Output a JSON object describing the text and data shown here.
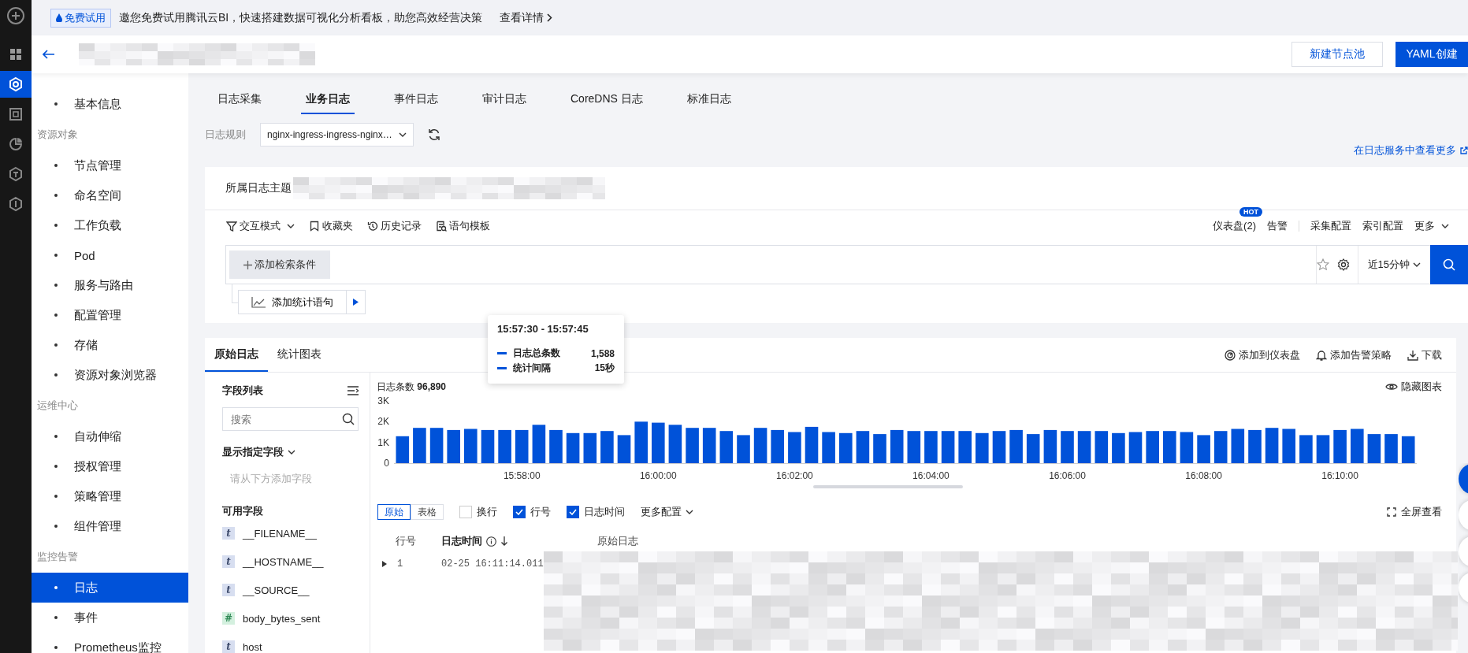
{
  "banner": {
    "tag": "免费试用",
    "message": "邀您免费试用腾讯云BI，快速搭建数据可视化分析看板，助您高效经营决策",
    "link": "查看详情"
  },
  "rail": {
    "items": [
      {
        "kind": "grid",
        "selected": false
      },
      {
        "kind": "hexagon",
        "selected": true
      },
      {
        "kind": "square",
        "selected": false
      },
      {
        "kind": "pie",
        "selected": false
      },
      {
        "kind": "hex-t",
        "selected": false
      },
      {
        "kind": "hex-i",
        "selected": false
      }
    ]
  },
  "header": {
    "buttons": [
      {
        "label": "新建节点池",
        "primary": false
      },
      {
        "label": "YAML创建",
        "primary": true
      }
    ]
  },
  "sidebar": {
    "items": [
      {
        "kind": "item",
        "label": "基本信息",
        "selected": false
      },
      {
        "kind": "group",
        "label": "资源对象"
      },
      {
        "kind": "item",
        "label": "节点管理",
        "selected": false
      },
      {
        "kind": "item",
        "label": "命名空间",
        "selected": false
      },
      {
        "kind": "item",
        "label": "工作负载",
        "selected": false
      },
      {
        "kind": "item",
        "label": "Pod",
        "selected": false
      },
      {
        "kind": "item",
        "label": "服务与路由",
        "selected": false
      },
      {
        "kind": "item",
        "label": "配置管理",
        "selected": false
      },
      {
        "kind": "item",
        "label": "存储",
        "selected": false
      },
      {
        "kind": "item",
        "label": "资源对象浏览器",
        "selected": false
      },
      {
        "kind": "group",
        "label": "运维中心"
      },
      {
        "kind": "item",
        "label": "自动伸缩",
        "selected": false
      },
      {
        "kind": "item",
        "label": "授权管理",
        "selected": false
      },
      {
        "kind": "item",
        "label": "策略管理",
        "selected": false
      },
      {
        "kind": "item",
        "label": "组件管理",
        "selected": false
      },
      {
        "kind": "group",
        "label": "监控告警"
      },
      {
        "kind": "item",
        "label": "日志",
        "selected": true
      },
      {
        "kind": "item",
        "label": "事件",
        "selected": false
      },
      {
        "kind": "item",
        "label": "Prometheus监控",
        "selected": false
      }
    ]
  },
  "tabs": [
    {
      "label": "日志采集",
      "selected": false
    },
    {
      "label": "业务日志",
      "selected": true
    },
    {
      "label": "事件日志",
      "selected": false
    },
    {
      "label": "审计日志",
      "selected": false
    },
    {
      "label": "CoreDNS 日志",
      "selected": false
    },
    {
      "label": "标准日志",
      "selected": false
    }
  ],
  "rule": {
    "label": "日志规则",
    "value": "nginx-ingress-ingress-nginx…"
  },
  "more_link": "在日志服务中查看更多",
  "topic": {
    "label": "所属日志主题"
  },
  "query_toolbar": {
    "left": [
      {
        "kind": "filter",
        "label": "交互模式",
        "dropdown": true
      },
      {
        "kind": "bookmark",
        "label": "收藏夹",
        "dropdown": false
      },
      {
        "kind": "history",
        "label": "历史记录",
        "dropdown": false
      },
      {
        "kind": "template",
        "label": "语句模板",
        "dropdown": false
      }
    ],
    "right": [
      {
        "label": "仪表盘(2)",
        "badge": "HOT",
        "dropdown": false
      },
      {
        "label": "告警",
        "dropdown": false
      },
      {
        "label": "采集配置",
        "dropdown": false
      },
      {
        "label": "索引配置",
        "dropdown": false
      },
      {
        "label": "更多",
        "dropdown": true
      }
    ]
  },
  "search": {
    "add_condition": "添加检索条件",
    "add_stats": "添加统计语句",
    "time_range": "近15分钟"
  },
  "results": {
    "tabs": [
      {
        "label": "原始日志",
        "selected": true
      },
      {
        "label": "统计图表",
        "selected": false
      }
    ],
    "actions": [
      {
        "kind": "dashboard",
        "label": "添加到仪表盘"
      },
      {
        "kind": "bell",
        "label": "添加告警策略"
      },
      {
        "kind": "download",
        "label": "下载"
      }
    ]
  },
  "fields": {
    "title": "字段列表",
    "search_placeholder": "搜索",
    "display_title": "显示指定字段",
    "display_hint": "请从下方添加字段",
    "available_title": "可用字段",
    "items": [
      {
        "type": "t",
        "name": "__FILENAME__"
      },
      {
        "type": "t",
        "name": "__HOSTNAME__"
      },
      {
        "type": "t",
        "name": "__SOURCE__"
      },
      {
        "type": "#",
        "name": "body_bytes_sent"
      },
      {
        "type": "t",
        "name": "host"
      }
    ]
  },
  "chart": {
    "count_label": "日志条数",
    "count": "96,890",
    "hide": "隐藏图表",
    "chart_data": {
      "type": "bar",
      "ylim": [
        0,
        3000
      ],
      "yticks": [
        {
          "value": 0,
          "label": "0"
        },
        {
          "value": 1000,
          "label": "1K"
        },
        {
          "value": 2000,
          "label": "2K"
        },
        {
          "value": 3000,
          "label": "3K"
        }
      ],
      "categories": [
        null,
        null,
        null,
        null,
        null,
        null,
        null,
        "15:58:00",
        null,
        null,
        null,
        null,
        null,
        null,
        null,
        "16:00:00",
        null,
        null,
        null,
        null,
        null,
        null,
        null,
        "16:02:00",
        null,
        null,
        null,
        null,
        null,
        null,
        null,
        "16:04:00",
        null,
        null,
        null,
        null,
        null,
        null,
        null,
        "16:06:00",
        null,
        null,
        null,
        null,
        null,
        null,
        null,
        "16:08:00",
        null,
        null,
        null,
        null,
        null,
        null,
        null,
        "16:10:00",
        null,
        null,
        null,
        null
      ],
      "values": [
        1300,
        1700,
        1700,
        1600,
        1650,
        1600,
        1600,
        1600,
        1850,
        1600,
        1450,
        1450,
        1550,
        1350,
        2000,
        1950,
        1850,
        1700,
        1700,
        1550,
        1350,
        1700,
        1600,
        1500,
        1750,
        1500,
        1450,
        1550,
        1400,
        1600,
        1550,
        1550,
        1550,
        1550,
        1450,
        1550,
        1600,
        1400,
        1600,
        1550,
        1550,
        1550,
        1450,
        1500,
        1550,
        1550,
        1500,
        1350,
        1550,
        1650,
        1600,
        1700,
        1650,
        1350,
        1350,
        1600,
        1650,
        1400,
        1400,
        1300
      ]
    }
  },
  "tooltip": {
    "title": "15:57:30 - 15:57:45",
    "rows": [
      {
        "label": "日志总条数",
        "value": "1,588"
      },
      {
        "label": "统计间隔",
        "value": "15秒"
      }
    ]
  },
  "view": {
    "modes": [
      {
        "label": "原始",
        "selected": true
      },
      {
        "label": "表格",
        "selected": false
      }
    ],
    "options": [
      {
        "label": "换行",
        "checked": false
      },
      {
        "label": "行号",
        "checked": true
      },
      {
        "label": "日志时间",
        "checked": true
      }
    ],
    "more": "更多配置",
    "fullscreen": "全屏查看"
  },
  "table": {
    "columns": [
      "行号",
      "日志时间",
      "原始日志"
    ],
    "rows": [
      {
        "expanded": false,
        "number": "1",
        "time": "02-25 16:11:14.011"
      }
    ]
  }
}
